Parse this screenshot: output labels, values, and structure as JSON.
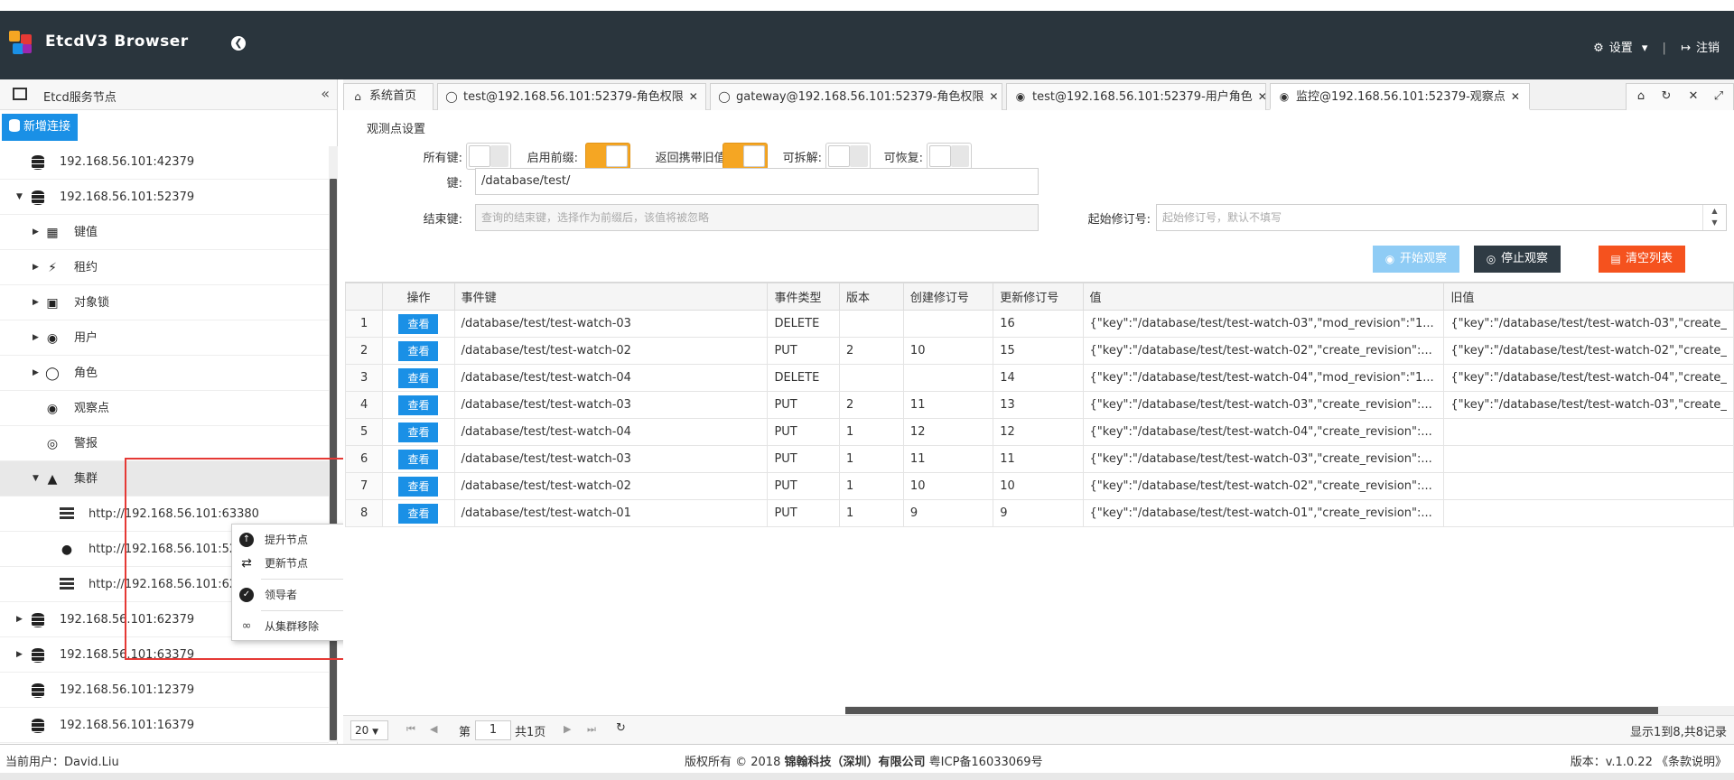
{
  "app": {
    "title": "EtcdV3 Browser"
  },
  "header": {
    "settings_label": "设置",
    "logout_label": "注销"
  },
  "sidebar": {
    "title": "Etcd服务节点",
    "add_label": "新增连接",
    "items": [
      {
        "label": "192.168.56.101:42379"
      },
      {
        "label": "192.168.56.101:52379"
      },
      {
        "label": "键值"
      },
      {
        "label": "租约"
      },
      {
        "label": "对象锁"
      },
      {
        "label": "用户"
      },
      {
        "label": "角色"
      },
      {
        "label": "观察点"
      },
      {
        "label": "警报"
      },
      {
        "label": "集群"
      },
      {
        "label": "http://192.168.56.101:63380"
      },
      {
        "label": "http://192.168.56.101:52"
      },
      {
        "label": "http://192.168.56.101:62"
      },
      {
        "label": "192.168.56.101:62379"
      },
      {
        "label": "192.168.56.101:63379"
      },
      {
        "label": "192.168.56.101:12379"
      },
      {
        "label": "192.168.56.101:16379"
      }
    ]
  },
  "context_menu": {
    "items": [
      {
        "label": "提升节点"
      },
      {
        "label": "更新节点"
      },
      {
        "label": "领导者"
      },
      {
        "label": "从集群移除"
      }
    ]
  },
  "tabs": [
    {
      "label": "系统首页"
    },
    {
      "label": "test@192.168.56.101:52379-角色权限"
    },
    {
      "label": "gateway@192.168.56.101:52379-角色权限"
    },
    {
      "label": "test@192.168.56.101:52379-用户角色"
    },
    {
      "label": "监控@192.168.56.101:52379-观察点"
    }
  ],
  "watch": {
    "section_title": "观测点设置",
    "all_keys_label": "所有键:",
    "prefix_label": "启用前缀:",
    "prev_kv_label": "返回携带旧值:",
    "fragment_label": "可拆解:",
    "progress_notify_label": "可恢复:",
    "key_label": "键:",
    "key_value": "/database/test/",
    "end_key_label": "结束键:",
    "end_key_placeholder": "查询的结束键，选择作为前缀后，该值将被忽略",
    "start_rev_label": "起始修订号:",
    "start_rev_placeholder": "起始修订号，默认不填写",
    "start_label": "开始观察",
    "stop_label": "停止观察",
    "clear_label": "清空列表"
  },
  "grid": {
    "headers": [
      "操作",
      "事件键",
      "事件类型",
      "版本",
      "创建修订号",
      "更新修订号",
      "值",
      "旧值"
    ],
    "view_label": "查看",
    "rows": [
      {
        "n": "1",
        "key": "/database/test/test-watch-03",
        "type": "DELETE",
        "ver": "",
        "crev": "",
        "urev": "16",
        "value": "{\"key\":\"/database/test/test-watch-03\",\"mod_revision\":\"1...",
        "old": "{\"key\":\"/database/test/test-watch-03\",\"create_"
      },
      {
        "n": "2",
        "key": "/database/test/test-watch-02",
        "type": "PUT",
        "ver": "2",
        "crev": "10",
        "urev": "15",
        "value": "{\"key\":\"/database/test/test-watch-02\",\"create_revision\":...",
        "old": "{\"key\":\"/database/test/test-watch-02\",\"create_"
      },
      {
        "n": "3",
        "key": "/database/test/test-watch-04",
        "type": "DELETE",
        "ver": "",
        "crev": "",
        "urev": "14",
        "value": "{\"key\":\"/database/test/test-watch-04\",\"mod_revision\":\"1...",
        "old": "{\"key\":\"/database/test/test-watch-04\",\"create_"
      },
      {
        "n": "4",
        "key": "/database/test/test-watch-03",
        "type": "PUT",
        "ver": "2",
        "crev": "11",
        "urev": "13",
        "value": "{\"key\":\"/database/test/test-watch-03\",\"create_revision\":...",
        "old": "{\"key\":\"/database/test/test-watch-03\",\"create_"
      },
      {
        "n": "5",
        "key": "/database/test/test-watch-04",
        "type": "PUT",
        "ver": "1",
        "crev": "12",
        "urev": "12",
        "value": "{\"key\":\"/database/test/test-watch-04\",\"create_revision\":...",
        "old": ""
      },
      {
        "n": "6",
        "key": "/database/test/test-watch-03",
        "type": "PUT",
        "ver": "1",
        "crev": "11",
        "urev": "11",
        "value": "{\"key\":\"/database/test/test-watch-03\",\"create_revision\":...",
        "old": ""
      },
      {
        "n": "7",
        "key": "/database/test/test-watch-02",
        "type": "PUT",
        "ver": "1",
        "crev": "10",
        "urev": "10",
        "value": "{\"key\":\"/database/test/test-watch-02\",\"create_revision\":...",
        "old": ""
      },
      {
        "n": "8",
        "key": "/database/test/test-watch-01",
        "type": "PUT",
        "ver": "1",
        "crev": "9",
        "urev": "9",
        "value": "{\"key\":\"/database/test/test-watch-01\",\"create_revision\":...",
        "old": ""
      }
    ]
  },
  "pager": {
    "page_size": "20",
    "page_prefix": "第",
    "page": "1",
    "page_suffix": "共1页",
    "summary": "显示1到8,共8记录"
  },
  "footer": {
    "user_label": "当前用户：David.Liu",
    "copyright_prefix": "版权所有 © 2018",
    "company": "锦翰科技（深圳）有限公司",
    "icp": "粤ICP备16033069号",
    "version": "版本：v.1.0.22 《条款说明》"
  },
  "colors": {
    "header_bg": "#2a353d",
    "primary": "#1a90e6",
    "dark": "#2f3b44",
    "danger": "#f5521e",
    "switch_on": "#f5a623",
    "highlight": "#e53935"
  }
}
